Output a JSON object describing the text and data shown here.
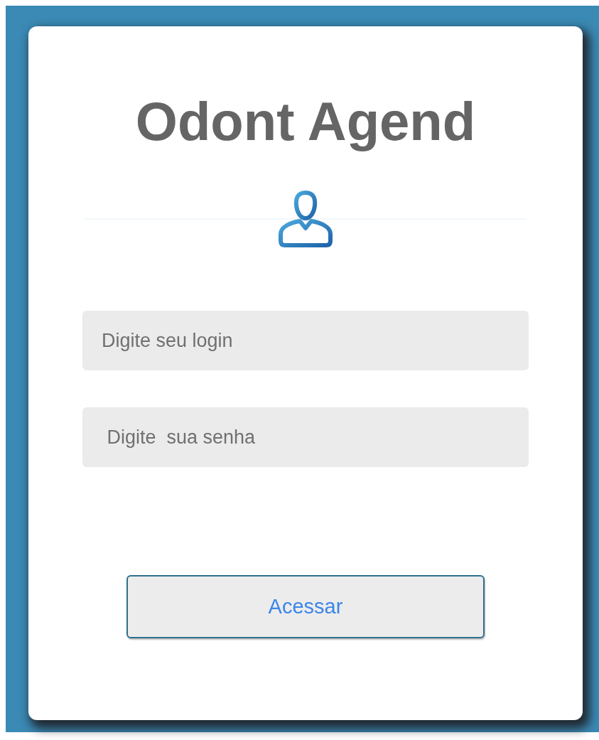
{
  "title": "Odont Agend",
  "fields": [
    {
      "placeholder": "Digite seu login"
    },
    {
      "placeholder": " Digite  sua senha"
    }
  ],
  "button": "Acessar"
}
